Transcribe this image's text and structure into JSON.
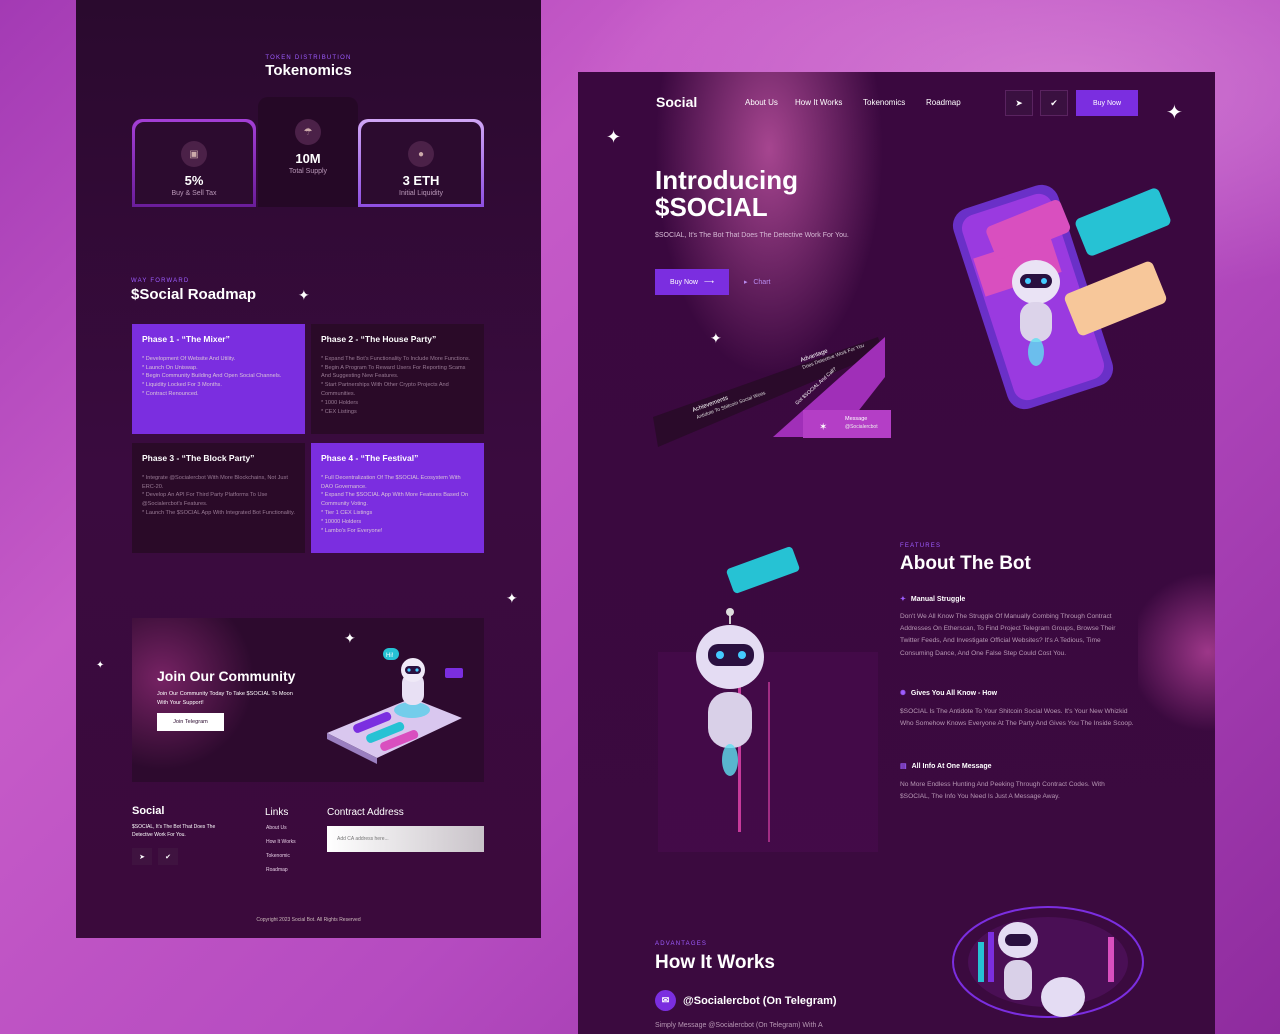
{
  "left": {
    "tokenomics": {
      "eyebrow": "TOKEN DISTRIBUTION",
      "title": "Tokenomics",
      "cards": [
        {
          "value": "5%",
          "label": "Buy & Sell Tax"
        },
        {
          "value": "10M",
          "label": "Total Supply"
        },
        {
          "value": "3 ETH",
          "label": "Initial Liquidity"
        }
      ]
    },
    "roadmap": {
      "eyebrow": "WAY FORWARD",
      "title": "$Social Roadmap",
      "phases": [
        {
          "title": "Phase 1 - “The Mixer”",
          "items": [
            "* Development Of Website And Utility.",
            "* Launch On Uniswap.",
            "* Begin Community Building And Open Social Channels.",
            "* Liquidity Locked For 3 Months.",
            "* Contract Renounced."
          ]
        },
        {
          "title": "Phase 2 - “The House Party”",
          "items": [
            "* Expand The Bot's Functionality To Include More Functions.",
            "* Begin A Program To Reward Users For Reporting Scams And Suggesting New Features.",
            "* Start Partnerships With Other Crypto Projects And Communities.",
            "* 1000 Holders",
            "* CEX Listings"
          ]
        },
        {
          "title": "Phase 3 - “The Block Party”",
          "items": [
            "* Integrate @Socialercbot With More Blockchains, Not Just ERC-20.",
            "* Develop An API For Third Party Platforms To Use @Socialercbot's Features.",
            "* Launch The $SOCIAL App With Integrated Bot Functionality."
          ]
        },
        {
          "title": "Phase 4 - “The Festival”",
          "items": [
            "* Full Decentralization Of The $SOCIAL Ecosystem With DAO Governance.",
            "* Expand The $SOCIAL App With More Features Based On Community Voting.",
            "* Tier 1 CEX Listings",
            "* 10000 Holders",
            "* Lambo's For Everyone!"
          ]
        }
      ]
    },
    "community": {
      "title": "Join Our Community",
      "text": "Join Our Community Today To Take $SOCIAL To Moon With Your Support!",
      "button": "Join Telegram",
      "bubble": "Hi!"
    },
    "footer": {
      "logo": "Social",
      "tagline": "$SOCIAL, It's The Bot That Does The Detective Work For You.",
      "links_title": "Links",
      "links": [
        "About Us",
        "How It Works",
        "Tokenomic",
        "Roadmap"
      ],
      "ca_title": "Contract Address",
      "ca_placeholder": "Add CA address here...",
      "copyright": "Copyright 2023 Social Bot. All Rights Reserved"
    }
  },
  "right": {
    "nav": {
      "logo": "Social",
      "links": [
        "About Us",
        "How It Works",
        "Tokenomics",
        "Roadmap"
      ],
      "buy": "Buy Now"
    },
    "hero": {
      "title_line1": "Introducing",
      "title_line2": "$SOCIAL",
      "subtitle": "$SOCIAL, It's The Bot That Does The Detective Work For You.",
      "buy": "Buy Now",
      "chart": "Chart"
    },
    "banner": {
      "achievements_label": "Achievements",
      "achievements_text": "Antidote To Shitcoin Social Woes",
      "advantage_label": "Advantage",
      "advantage_text": "Does Detective Work For You",
      "middle_text": "Got $SOCIAL And Call?",
      "message_label": "Message",
      "message_text": "@Socialercbot"
    },
    "features": {
      "eyebrow": "FEATURES",
      "title": "About The Bot",
      "items": [
        {
          "title": "Manual Struggle",
          "text": "Don't We All Know The Struggle Of Manually Combing Through Contract Addresses On Etherscan, To Find Project Telegram Groups, Browse Their Twitter Feeds, And Investigate Official Websites? It's A Tedious, Time Consuming Dance, And One False Step Could Cost You."
        },
        {
          "title": "Gives You All Know - How",
          "text": "$SOCIAL Is The Antidote To Your Shitcoin Social Woes. It's Your New Whizkid Who Somehow Knows Everyone At The Party And Gives You The Inside Scoop."
        },
        {
          "title": "All Info At One Message",
          "text": "No More Endless Hunting And Peeking Through Contract Codes. With $SOCIAL, The Info You Need Is Just A Message Away."
        }
      ]
    },
    "how": {
      "eyebrow": "ADVANTAGES",
      "title": "How It Works",
      "handle": "@Socialercbot (On Telegram)",
      "text": "Simply Message @Socialercbot (On Telegram) With A"
    }
  },
  "colors": {
    "accent": "#7b2ee0",
    "panel": "#3a083f",
    "eyebrow": "#9d5cff"
  }
}
